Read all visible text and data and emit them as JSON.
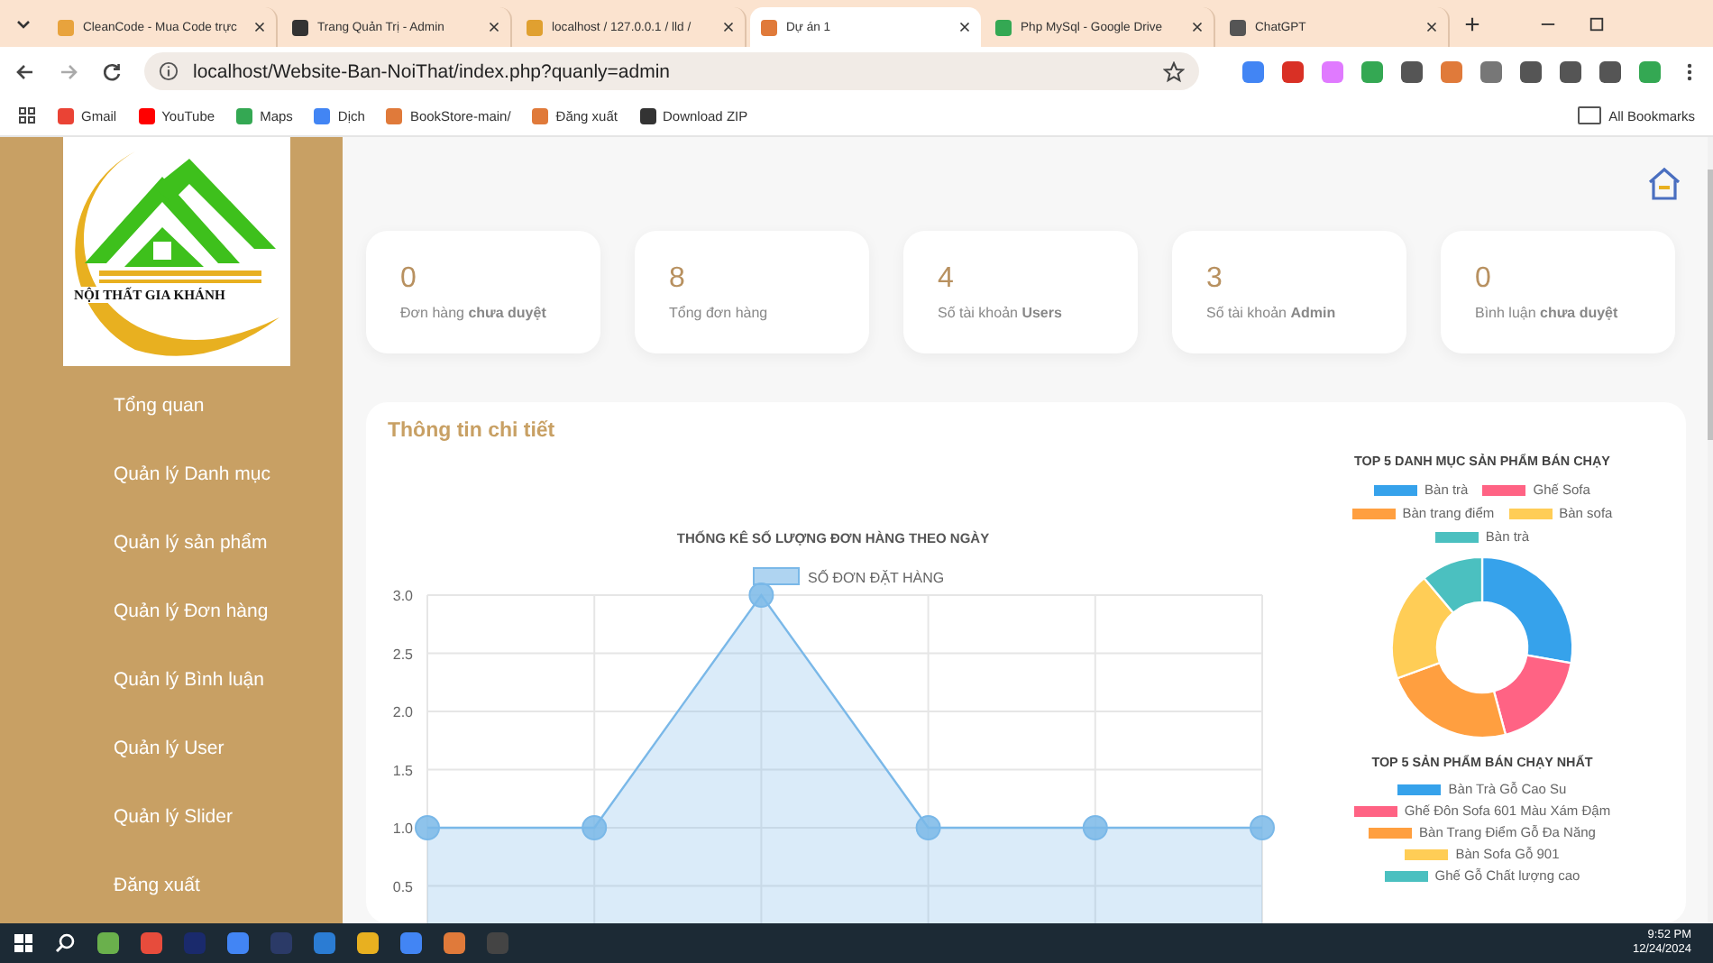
{
  "browser": {
    "tabs": [
      {
        "title": "CleanCode - Mua Code trực",
        "selected": false,
        "color": "#e8a33d"
      },
      {
        "title": "Trang Quản Trị - Admin",
        "selected": false,
        "color": "#333333"
      },
      {
        "title": "localhost / 127.0.0.1 / lld /",
        "selected": false,
        "color": "#e0a030"
      },
      {
        "title": "Dự án 1",
        "selected": true,
        "color": "#e07a3a"
      },
      {
        "title": "Php MySql - Google Drive",
        "selected": false,
        "color": "#34a853"
      },
      {
        "title": "ChatGPT",
        "selected": false,
        "color": "#555555"
      }
    ],
    "url": "localhost/Website-Ban-NoiThat/index.php?quanly=admin",
    "bookmarks": [
      {
        "label": "Gmail",
        "color": "#ea4335"
      },
      {
        "label": "YouTube",
        "color": "#ff0000"
      },
      {
        "label": "Maps",
        "color": "#34a853"
      },
      {
        "label": "Dịch",
        "color": "#4285f4"
      },
      {
        "label": "BookStore-main/",
        "color": "#e07a3a"
      },
      {
        "label": "Đăng xuất",
        "color": "#e07a3a"
      },
      {
        "label": "Download ZIP",
        "color": "#333333"
      }
    ],
    "all_bookmarks": "All Bookmarks"
  },
  "sidebar": {
    "logo_text": "NỘI THẤT GIA KHÁNH",
    "items": [
      "Tổng quan",
      "Quản lý Danh mục",
      "Quản lý sản phẩm",
      "Quản lý Đơn hàng",
      "Quản lý Bình luận",
      "Quản lý User",
      "Quản lý Slider",
      "Đăng xuất"
    ]
  },
  "stats": [
    {
      "value": "0",
      "label": "Đơn hàng **chưa duyệt**"
    },
    {
      "value": "8",
      "label": "Tổng đơn hàng"
    },
    {
      "value": "4",
      "label": "Số tài khoản **Users**"
    },
    {
      "value": "3",
      "label": "Số tài khoản **Admin**"
    },
    {
      "value": "0",
      "label": "Bình luận **chưa duyệt**"
    }
  ],
  "detail": {
    "title": "Thông tin chi tiết",
    "orders_chart": {
      "chart_data": {
        "type": "area",
        "title": "THỐNG KÊ SỐ LƯỢNG ĐƠN HÀNG THEO NGÀY",
        "series": [
          {
            "name": "SỐ ĐƠN ĐẶT HÀNG",
            "color": "#7ab8e8",
            "values": [
              1,
              1,
              3,
              1,
              1,
              1
            ]
          }
        ],
        "ylim": [
          0,
          3
        ],
        "grid": true,
        "yticks": [
          {
            "value": 0.5,
            "label": "0.5"
          },
          {
            "value": 1,
            "label": "1.0"
          },
          {
            "value": 1.5,
            "label": "1.5"
          },
          {
            "value": 2,
            "label": "2.0"
          },
          {
            "value": 2.5,
            "label": "2.5"
          },
          {
            "value": 3,
            "label": "3.0"
          }
        ]
      }
    },
    "category_chart": {
      "title": "TOP 5 DANH MỤC SẢN PHẨM BÁN CHẠY",
      "legend": [
        {
          "label": "Bàn trà",
          "color": "#36a2eb"
        },
        {
          "label": "Ghế Sofa",
          "color": "#ff6384"
        },
        {
          "label": "Bàn trang điểm",
          "color": "#ff9f40"
        },
        {
          "label": "Bàn sofa",
          "color": "#ffcd56"
        },
        {
          "label": "Bàn trà",
          "color": "#4bc0c0"
        }
      ]
    },
    "product_chart": {
      "title": "TOP 5 SẢN PHẨM BÁN CHẠY NHẤT",
      "legend": [
        {
          "label": "Bàn  Trà Gỗ Cao Su",
          "color": "#36a2eb"
        },
        {
          "label": "Ghế Đôn Sofa 601 Màu Xám Đậm",
          "color": "#ff6384"
        },
        {
          "label": "Bàn Trang Điểm Gỗ Đa Năng",
          "color": "#ff9f40"
        },
        {
          "label": "Bàn Sofa Gỗ  901",
          "color": "#ffcd56"
        },
        {
          "label": "Ghế Gỗ Chất lượng cao",
          "color": "#4bc0c0"
        }
      ]
    }
  },
  "taskbar": {
    "time": "9:52 PM",
    "date": "12/24/2024"
  }
}
